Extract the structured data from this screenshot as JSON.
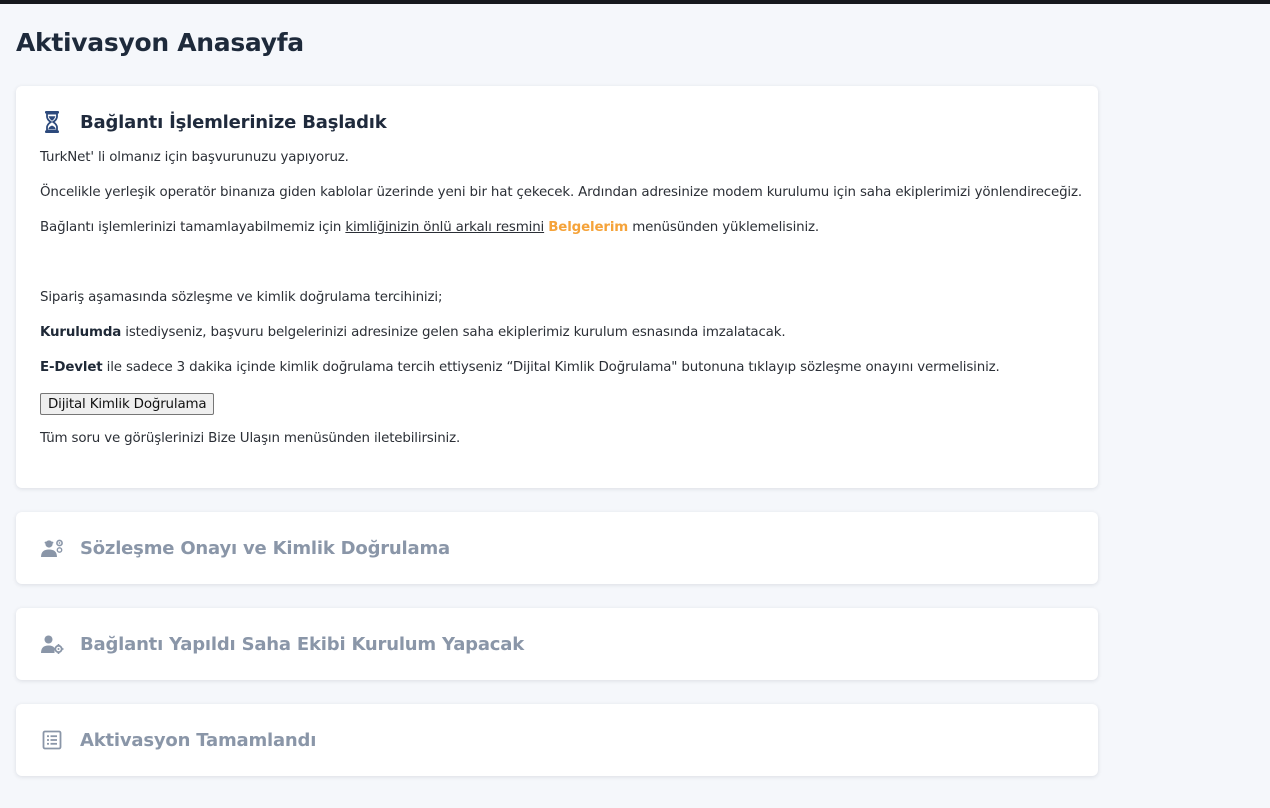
{
  "page": {
    "title": "Aktivasyon Anasayfa"
  },
  "steps": {
    "active": {
      "title": "Bağlantı İşlemlerinize Başladık",
      "icon": "hourglass-icon",
      "line1": "TurkNet' li olmanız için başvurunuzu yapıyoruz.",
      "line2": "Öncelikle yerleşik operatör binanıza giden kablolar üzerinde yeni bir hat çekecek. Ardından adresinize modem kurulumu için saha ekiplerimizi yönlendireceğiz.",
      "line3_prefix": "Bağlantı işlemlerinizi tamamlayabilmemiz için ",
      "line3_link": "kimliğinizin önlü arkalı resmini",
      "line3_highlight": "Belgelerim",
      "line3_suffix": " menüsünden yüklemelisiniz.",
      "line4": "Sipariş aşamasında sözleşme ve kimlik doğrulama tercihinizi;",
      "line5_bold": "Kurulumda",
      "line5_rest": " istediyseniz, başvuru belgelerinizi adresinize gelen saha ekiplerimiz kurulum esnasında imzalatacak.",
      "line6_bold": "E-Devlet",
      "line6_rest": " ile sadece 3 dakika içinde kimlik doğrulama tercih ettiyseniz “Dijital Kimlik Doğrulama\" butonuna tıklayıp sözleşme onayını vermelisiniz.",
      "button_label": "Dijital Kimlik Doğrulama",
      "line8": "Tüm soru ve görüşlerinizi Bize Ulaşın menüsünden iletebilirsiniz."
    },
    "pending": [
      {
        "title": "Sözleşme Onayı ve Kimlik Doğrulama",
        "icon": "user-settings-icon"
      },
      {
        "title": "Bağlantı Yapıldı Saha Ekibi Kurulum Yapacak",
        "icon": "user-gear-icon"
      },
      {
        "title": "Aktivasyon Tamamlandı",
        "icon": "checklist-icon"
      }
    ]
  },
  "colors": {
    "accent": "#f5a33a",
    "title": "#1e2a3b",
    "muted": "#8a96a8",
    "icon_active": "#2d4a7c"
  }
}
